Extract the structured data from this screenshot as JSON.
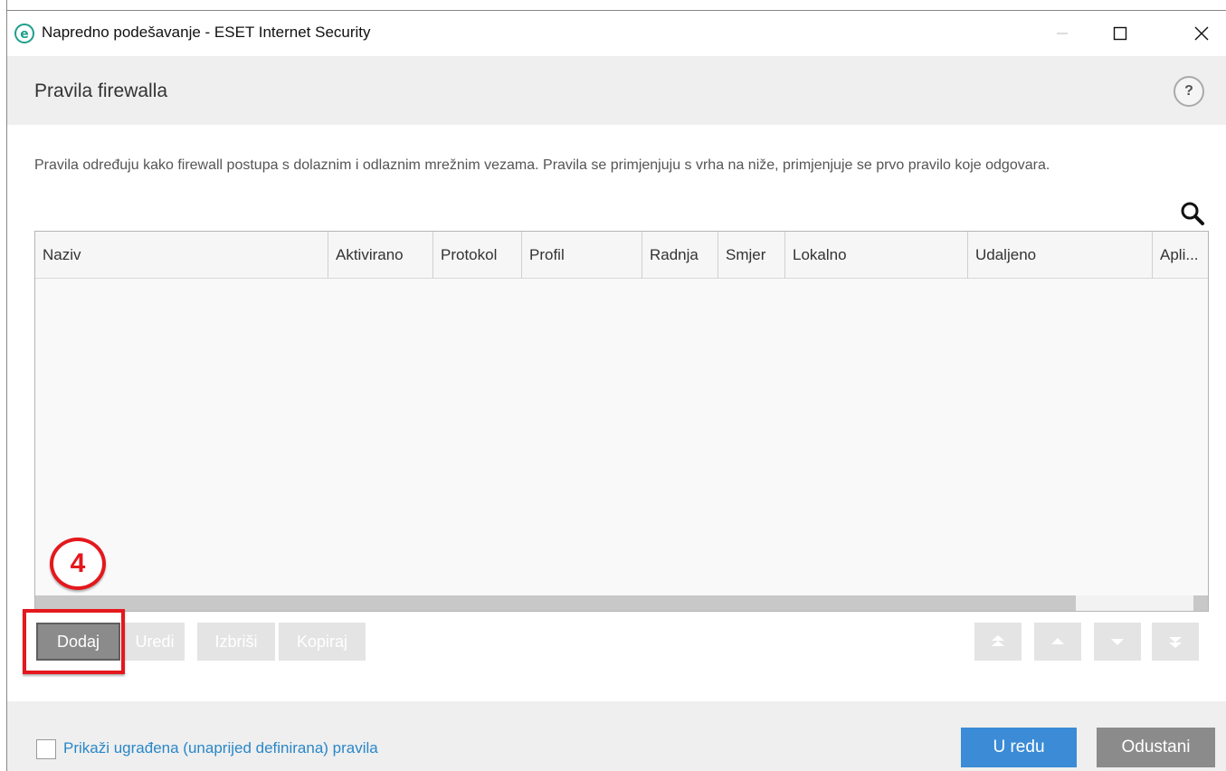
{
  "window": {
    "title": "Napredno podešavanje - ESET Internet Security",
    "app_icon_letter": "e",
    "accent_color": "#1e9f8d"
  },
  "header": {
    "title": "Pravila firewalla",
    "help_glyph": "?"
  },
  "description": "Pravila određuju kako firewall postupa s dolaznim i odlaznim mrežnim vezama. Pravila se primjenjuju s vrha na niže, primjenjuje se prvo pravilo koje odgovara.",
  "table": {
    "columns": [
      "Naziv",
      "Aktivirano",
      "Protokol",
      "Profil",
      "Radnja",
      "Smjer",
      "Lokalno",
      "Udaljeno",
      "Apli..."
    ],
    "rows": []
  },
  "actions": {
    "add": "Dodaj",
    "edit": "Uredi",
    "delete": "Izbriši",
    "copy": "Kopiraj"
  },
  "annotation": {
    "step_number": "4",
    "color": "#e4181d"
  },
  "footer": {
    "show_builtin_label": "Prikaži ugrađena (unaprijed definirana) pravila",
    "show_builtin_checked": false,
    "ok": "U redu",
    "cancel": "Odustani"
  }
}
